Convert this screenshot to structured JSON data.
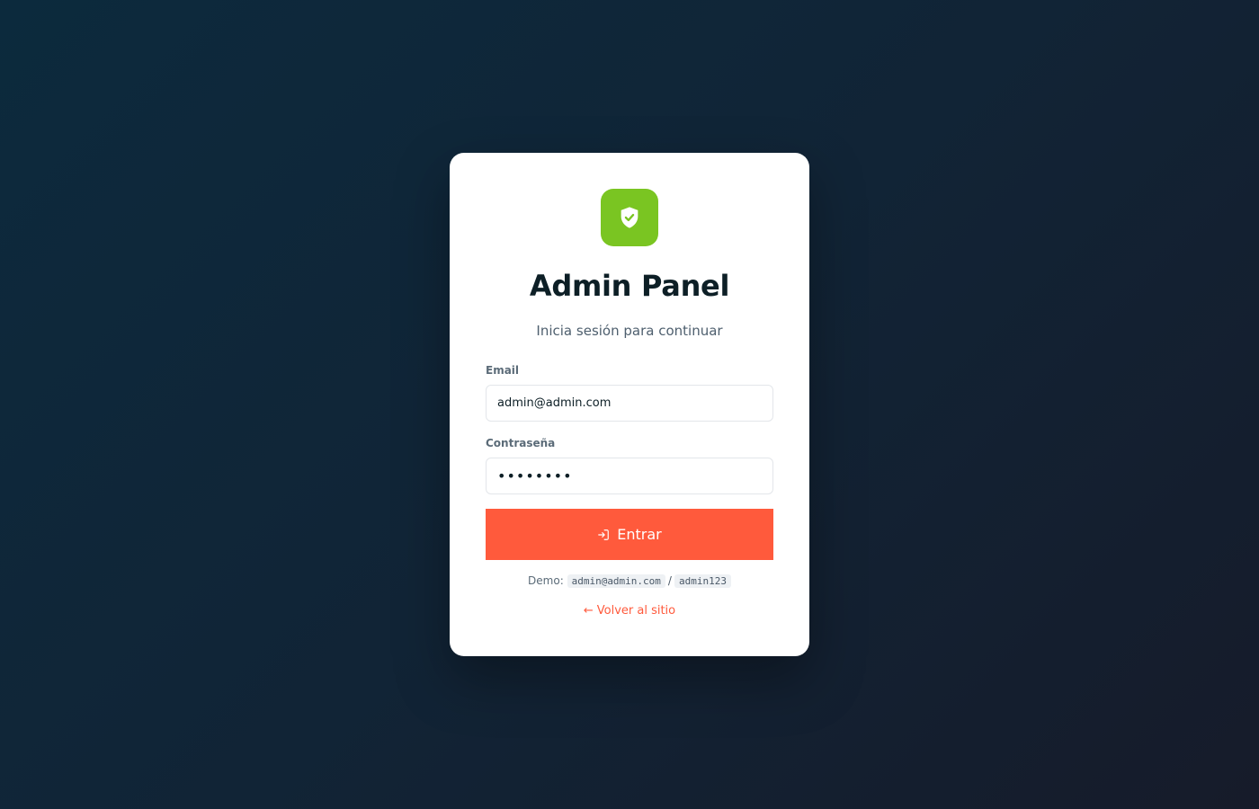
{
  "brand": {
    "accent_color": "#7ac522",
    "button_color": "#ff5a3c",
    "logo_icon": "shield-check-icon"
  },
  "header": {
    "title": "Admin Panel",
    "subtitle": "Inicia sesión para continuar"
  },
  "form": {
    "email_label": "Email",
    "email_value": "admin@admin.com",
    "password_label": "Contraseña",
    "password_value": "••••••••",
    "submit_label": "Entrar",
    "submit_icon": "login-icon"
  },
  "demo": {
    "prefix": "Demo:",
    "email": "admin@admin.com",
    "separator": "/",
    "password": "admin123"
  },
  "back_link": {
    "arrow": "←",
    "label": "Volver al sitio"
  }
}
